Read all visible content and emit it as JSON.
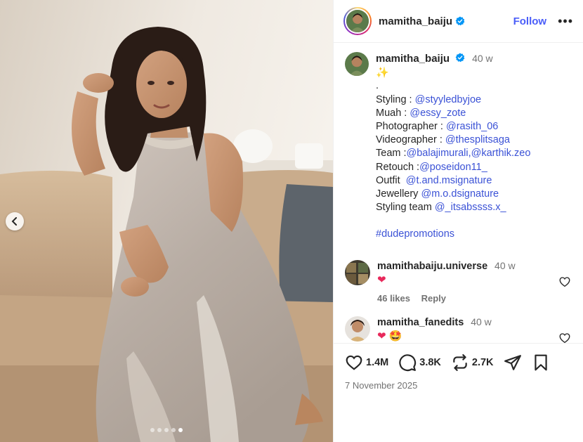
{
  "post": {
    "username": "mamitha_baiju",
    "follow_label": "Follow",
    "more_label": "•••",
    "time": "40 w",
    "sparkle": "✨",
    "caption_lines": [
      {
        "prefix": ".",
        "mention": ""
      },
      {
        "prefix": "Styling : ",
        "mention": "@styyledbyjoe"
      },
      {
        "prefix": "Muah : ",
        "mention": "@essy_zote"
      },
      {
        "prefix": "Photographer : ",
        "mention": "@rasith_06"
      },
      {
        "prefix": "Videographer : ",
        "mention": "@thesplitsaga"
      },
      {
        "prefix": "Team :",
        "mention": "@balajimurali,@karthik.zeo"
      },
      {
        "prefix": "Retouch :",
        "mention": "@poseidon11_"
      },
      {
        "prefix": "Outfit  ",
        "mention": "@t.and.msignature"
      },
      {
        "prefix": "Jewellery ",
        "mention": "@m.o.dsignature"
      },
      {
        "prefix": "Styling team ",
        "mention": "@_itsabssss.x_"
      }
    ],
    "hashtag": "#dudepromotions",
    "date": "7 November 2025"
  },
  "comments": [
    {
      "username": "mamithabaiju.universe",
      "time": "40 w",
      "text": "❤",
      "likes": "46 likes",
      "reply": "Reply"
    },
    {
      "username": "mamitha_fanedits",
      "time": "40 w",
      "text": "❤ 🤩"
    }
  ],
  "actions": {
    "likes": "1.4M",
    "comments": "3.8K",
    "reposts": "2.7K"
  },
  "carousel": {
    "count": 5,
    "active_index": 4
  },
  "colors": {
    "accent": "#4a5df9",
    "mention": "#3b52d6",
    "muted": "#737373",
    "heart": "#e8295b"
  }
}
